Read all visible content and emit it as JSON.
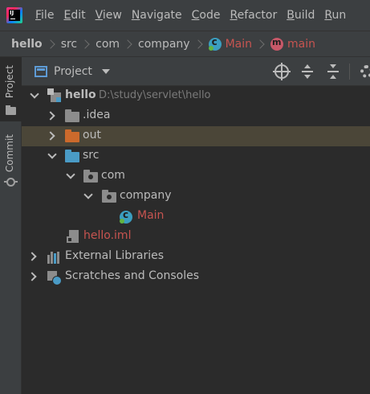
{
  "menubar": {
    "items": [
      {
        "mnemonic": "F",
        "rest": "ile"
      },
      {
        "mnemonic": "E",
        "rest": "dit"
      },
      {
        "mnemonic": "V",
        "rest": "iew"
      },
      {
        "mnemonic": "N",
        "rest": "avigate"
      },
      {
        "mnemonic": "C",
        "rest": "ode"
      },
      {
        "mnemonic": "R",
        "rest": "efactor"
      },
      {
        "mnemonic": "B",
        "rest": "uild"
      },
      {
        "mnemonic": "R",
        "rest": "un"
      }
    ]
  },
  "breadcrumb": {
    "items": [
      "hello",
      "src",
      "com",
      "company",
      "Main",
      "main"
    ]
  },
  "stripe": {
    "project_label": "Project",
    "commit_label": "Commit"
  },
  "project_panel": {
    "title": "Project"
  },
  "tree": {
    "root": {
      "label": "hello",
      "path": "D:\\study\\servlet\\hello"
    },
    "idea": {
      "label": ".idea"
    },
    "out": {
      "label": "out"
    },
    "src": {
      "label": "src"
    },
    "com": {
      "label": "com"
    },
    "company": {
      "label": "company"
    },
    "main": {
      "label": "Main"
    },
    "iml": {
      "label": "hello.iml"
    },
    "libraries": {
      "label": "External Libraries"
    },
    "scratches": {
      "label": "Scratches and Consoles"
    }
  },
  "colors": {
    "background": "#2b2b2b",
    "chrome": "#3c3f41",
    "selected_row": "#4b4638",
    "error_red": "#c75450",
    "folder_blue": "#4a9bc6",
    "folder_orange": "#cc6a2c"
  }
}
